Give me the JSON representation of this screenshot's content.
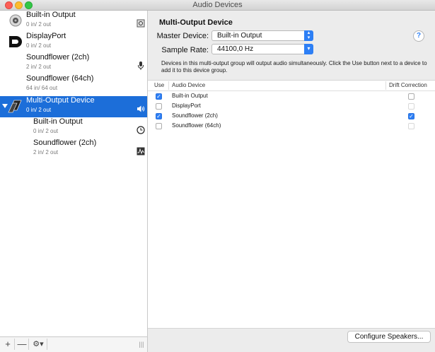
{
  "window": {
    "title": "Audio Devices"
  },
  "sidebar": {
    "devices": [
      {
        "name": "Built-in Output",
        "channels": "0 in/ 2 out",
        "icon": "speaker-icon",
        "right_icon": "finder-icon"
      },
      {
        "name": "DisplayPort",
        "channels": "0 in/ 2 out",
        "icon": "displayport-icon",
        "right_icon": ""
      },
      {
        "name": "Soundflower (2ch)",
        "channels": "2 in/ 2 out",
        "icon": "",
        "right_icon": "microphone-icon"
      },
      {
        "name": "Soundflower (64ch)",
        "channels": "64 in/ 64 out",
        "icon": "",
        "right_icon": ""
      },
      {
        "name": "Multi-Output Device",
        "channels": "0 in/ 2 out",
        "icon": "multi-output-icon",
        "right_icon": "volume-icon",
        "selected": true
      }
    ],
    "subdevices": [
      {
        "name": "Built-in Output",
        "channels": "0 in/ 2 out",
        "right_icon": "clock-icon"
      },
      {
        "name": "Soundflower (2ch)",
        "channels": "2 in/ 2 out",
        "right_icon": "waveform-icon"
      }
    ],
    "toolbar": {
      "add": "+",
      "remove": "—",
      "gear": "⚙︎▾",
      "resize": "|||"
    }
  },
  "main": {
    "heading": "Multi-Output Device",
    "master_label": "Master Device:",
    "master_value": "Built-in Output",
    "rate_label": "Sample Rate:",
    "rate_value": "44100,0 Hz",
    "help": "?",
    "description": "Devices in this multi-output group will output audio simultaneously. Click the Use button next to a device to add it to this device group.",
    "table": {
      "headers": {
        "use": "Use",
        "device": "Audio Device",
        "drift": "Drift Correction"
      },
      "rows": [
        {
          "name": "Built-in Output",
          "use": true,
          "drift": false,
          "drift_enabled": true
        },
        {
          "name": "DisplayPort",
          "use": false,
          "drift": false,
          "drift_enabled": false
        },
        {
          "name": "Soundflower (2ch)",
          "use": true,
          "drift": true,
          "drift_enabled": true
        },
        {
          "name": "Soundflower (64ch)",
          "use": false,
          "drift": false,
          "drift_enabled": false
        }
      ]
    },
    "configure_button": "Configure Speakers..."
  },
  "colors": {
    "selection": "#1c6ed9",
    "accent": "#2d7ff5"
  }
}
